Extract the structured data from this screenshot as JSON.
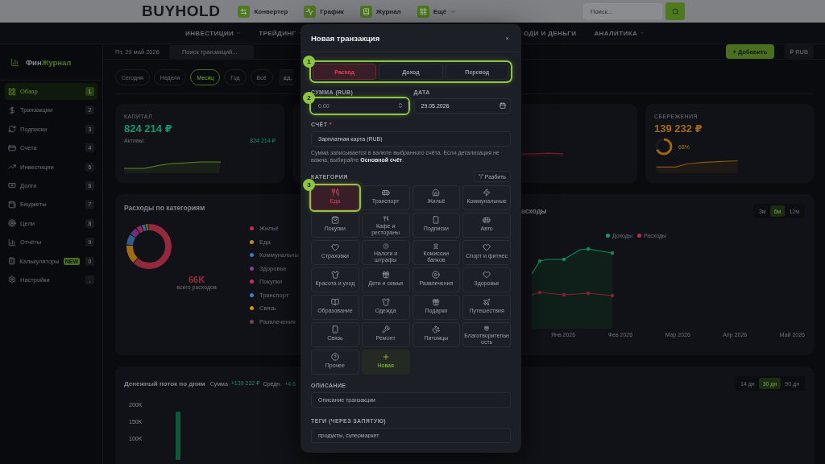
{
  "topbar": {
    "logo": "BUYHOLD",
    "nav": [
      {
        "label": "Конвертер",
        "dropdown": false
      },
      {
        "label": "График",
        "dropdown": false
      },
      {
        "label": "Журнал",
        "dropdown": false
      },
      {
        "label": "Ещё",
        "dropdown": true
      }
    ],
    "search": {
      "placeholder": "Поиск..."
    }
  },
  "menu": {
    "left": [
      {
        "label": "ИНВЕСТИЦИИ",
        "dropdown": true
      },
      {
        "label": "ТРЕЙДИНГ",
        "dropdown": true
      }
    ],
    "right": [
      {
        "label": "ОДИ И ДЕНЬГИ",
        "dropdown": false
      },
      {
        "label": "АНАЛИТИКА",
        "dropdown": true
      }
    ]
  },
  "sidebar": {
    "logo_parts": [
      "Фин",
      "Журнал"
    ],
    "items": [
      {
        "label": "Обзор",
        "shortcut": "1",
        "selected": true
      },
      {
        "label": "Транзакции",
        "shortcut": "2",
        "selected": false
      },
      {
        "label": "Подписки",
        "shortcut": "3",
        "selected": false
      },
      {
        "label": "Счета",
        "shortcut": "4",
        "selected": false
      },
      {
        "label": "Инвестиции",
        "shortcut": "5",
        "selected": false
      },
      {
        "label": "Долги",
        "shortcut": "6",
        "selected": false
      },
      {
        "label": "Бюджеты",
        "shortcut": "7",
        "selected": false
      },
      {
        "label": "Цели",
        "shortcut": "8",
        "selected": false
      },
      {
        "label": "Отчёты",
        "shortcut": "9",
        "selected": false
      },
      {
        "label": "Калькуляторы",
        "shortcut": "0",
        "selected": false,
        "badge": "NEW"
      },
      {
        "label": "Настройки",
        "shortcut": ",",
        "selected": false
      }
    ]
  },
  "header": {
    "date": "Пт, 29 май 2026",
    "search": {
      "placeholder": "Поиск транзакций..."
    },
    "add_button": "+ Добавить",
    "currency_button": "₽ RUB"
  },
  "period_filters": [
    {
      "label": "Сегодня",
      "selected": false
    },
    {
      "label": "Неделя",
      "selected": false
    },
    {
      "label": "Месяц",
      "selected": true
    },
    {
      "label": "Год",
      "selected": false
    },
    {
      "label": "Всё",
      "selected": false
    }
  ],
  "date_field": {
    "placeholder": "дд."
  },
  "capital_card": {
    "title": "КАПИТАЛ",
    "value": "824 214 ₽",
    "assets_label": "Активы:",
    "assets_value": "824 214 ₽"
  },
  "savings_card": {
    "title": "СБЕРЕЖЕНИЯ",
    "value": "139 232 ₽",
    "level": 0.68,
    "percent": "68%"
  },
  "expenses_card": {
    "title": "Расходы по категориям",
    "total": "66K",
    "total_caption": "всего расходов",
    "legend": [
      {
        "label": "Жильё",
        "color": "#c0304a"
      },
      {
        "label": "Еда",
        "color": "#d08a10"
      },
      {
        "label": "Коммунальны",
        "color": "#3a78b8"
      },
      {
        "label": "Здоровье",
        "color": "#8e3a9c"
      },
      {
        "label": "Покупки",
        "color": "#c83060"
      },
      {
        "label": "Транспорт",
        "color": "#3a7ec0"
      },
      {
        "label": "Связь",
        "color": "#d0901a"
      },
      {
        "label": "Развлечения",
        "color": "#6a4a50"
      }
    ]
  },
  "income_chart_card": {
    "title": "асходы",
    "ranges": [
      {
        "label": "3м",
        "selected": false
      },
      {
        "label": "6м",
        "selected": true
      },
      {
        "label": "12м",
        "selected": false
      }
    ],
    "legend": [
      {
        "label": "Доходы",
        "color": "#14a06a"
      },
      {
        "label": "Расходы",
        "color": "#c0304a"
      }
    ],
    "x_labels": [
      "Янв 2026",
      "Фев 2026",
      "Мар 2026",
      "Апр 2026",
      "Май 2026"
    ]
  },
  "cashflow_card": {
    "title": "Денежный поток по дням",
    "sum_label": "Сумма",
    "sum_value": "+139 232 ₽",
    "avg_label": "Средн.",
    "avg_value": "+4 6",
    "ranges": [
      {
        "label": "14 дн",
        "selected": false
      },
      {
        "label": "30 дн",
        "selected": true
      },
      {
        "label": "90 дн",
        "selected": false
      }
    ],
    "y_ticks": [
      "200K",
      "150K",
      "100K"
    ]
  },
  "modal": {
    "title": "Новая транзакция",
    "close": "×",
    "type_tabs": {
      "step": "1",
      "tabs": [
        {
          "label": "Расход",
          "selected": true
        },
        {
          "label": "Доход",
          "selected": false
        },
        {
          "label": "Перевод",
          "selected": false
        }
      ]
    },
    "amount": {
      "label": "СУММА (RUB)",
      "placeholder": "0.00",
      "step": "2"
    },
    "date": {
      "label": "ДАТА",
      "value": "29.05.2026"
    },
    "account": {
      "label": "СЧЁТ",
      "required_mark": "*",
      "value": "Зарплатная карта (RUB)",
      "hint": "Сумма записывается в валюте выбранного счёта. Если детализация не важна, выбирайте **Основной счёт**."
    },
    "category": {
      "label": "КАТЕГОРИЯ",
      "split_button": "Разбить",
      "step": "3",
      "items": [
        {
          "label": "Еда",
          "kind": "category",
          "selected": true
        },
        {
          "label": "Транспорт",
          "kind": "category",
          "selected": false
        },
        {
          "label": "Жильё",
          "kind": "category",
          "selected": false
        },
        {
          "label": "Коммунальные",
          "kind": "category",
          "selected": false
        },
        {
          "label": "Покупки",
          "kind": "category",
          "selected": false
        },
        {
          "label": "Кафе и рестораны",
          "kind": "category",
          "selected": false
        },
        {
          "label": "Подписки",
          "kind": "category",
          "selected": false
        },
        {
          "label": "Авто",
          "kind": "category",
          "selected": false
        },
        {
          "label": "Страховки",
          "kind": "category",
          "selected": false
        },
        {
          "label": "Налоги и штрафы",
          "kind": "category",
          "selected": false
        },
        {
          "label": "Комиссии банков",
          "kind": "category",
          "selected": false
        },
        {
          "label": "Спорт и фитнес",
          "kind": "category",
          "selected": false
        },
        {
          "label": "Красота и уход",
          "kind": "category",
          "selected": false
        },
        {
          "label": "Дети и семья",
          "kind": "category",
          "selected": false
        },
        {
          "label": "Развлечения",
          "kind": "category",
          "selected": false
        },
        {
          "label": "Здоровье",
          "kind": "category",
          "selected": false
        },
        {
          "label": "Образование",
          "kind": "category",
          "selected": false
        },
        {
          "label": "Одежда",
          "kind": "category",
          "selected": false
        },
        {
          "label": "Подарки",
          "kind": "category",
          "selected": false
        },
        {
          "label": "Путешествия",
          "kind": "category",
          "selected": false
        },
        {
          "label": "Связь",
          "kind": "category",
          "selected": false
        },
        {
          "label": "Ремонт",
          "kind": "category",
          "selected": false
        },
        {
          "label": "Питомцы",
          "kind": "category",
          "selected": false
        },
        {
          "label": "Благотворительность",
          "kind": "category",
          "selected": false
        },
        {
          "label": "Прочее",
          "kind": "category",
          "selected": false
        },
        {
          "label": "Новая",
          "kind": "add",
          "selected": false
        }
      ]
    },
    "description": {
      "label": "ОПИСАНИЕ",
      "placeholder": "Описание транзакции"
    },
    "tags": {
      "label": "ТЕГИ (ЧЕРЕЗ ЗАПЯТУЮ)",
      "placeholder": "продукты, супермаркет"
    }
  }
}
